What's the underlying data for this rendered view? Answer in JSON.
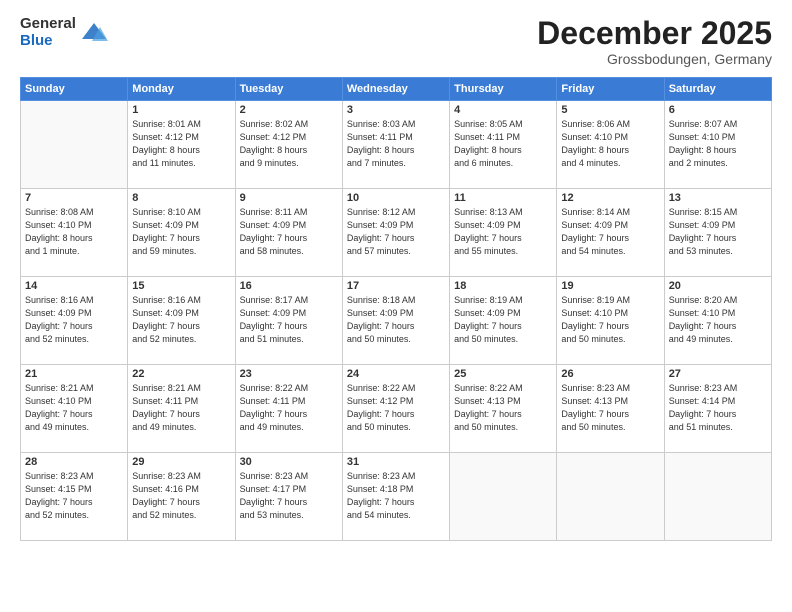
{
  "logo": {
    "general": "General",
    "blue": "Blue"
  },
  "title": "December 2025",
  "location": "Grossbodungen, Germany",
  "days_header": [
    "Sunday",
    "Monday",
    "Tuesday",
    "Wednesday",
    "Thursday",
    "Friday",
    "Saturday"
  ],
  "weeks": [
    [
      {
        "day": "",
        "info": ""
      },
      {
        "day": "1",
        "info": "Sunrise: 8:01 AM\nSunset: 4:12 PM\nDaylight: 8 hours\nand 11 minutes."
      },
      {
        "day": "2",
        "info": "Sunrise: 8:02 AM\nSunset: 4:12 PM\nDaylight: 8 hours\nand 9 minutes."
      },
      {
        "day": "3",
        "info": "Sunrise: 8:03 AM\nSunset: 4:11 PM\nDaylight: 8 hours\nand 7 minutes."
      },
      {
        "day": "4",
        "info": "Sunrise: 8:05 AM\nSunset: 4:11 PM\nDaylight: 8 hours\nand 6 minutes."
      },
      {
        "day": "5",
        "info": "Sunrise: 8:06 AM\nSunset: 4:10 PM\nDaylight: 8 hours\nand 4 minutes."
      },
      {
        "day": "6",
        "info": "Sunrise: 8:07 AM\nSunset: 4:10 PM\nDaylight: 8 hours\nand 2 minutes."
      }
    ],
    [
      {
        "day": "7",
        "info": "Sunrise: 8:08 AM\nSunset: 4:10 PM\nDaylight: 8 hours\nand 1 minute."
      },
      {
        "day": "8",
        "info": "Sunrise: 8:10 AM\nSunset: 4:09 PM\nDaylight: 7 hours\nand 59 minutes."
      },
      {
        "day": "9",
        "info": "Sunrise: 8:11 AM\nSunset: 4:09 PM\nDaylight: 7 hours\nand 58 minutes."
      },
      {
        "day": "10",
        "info": "Sunrise: 8:12 AM\nSunset: 4:09 PM\nDaylight: 7 hours\nand 57 minutes."
      },
      {
        "day": "11",
        "info": "Sunrise: 8:13 AM\nSunset: 4:09 PM\nDaylight: 7 hours\nand 55 minutes."
      },
      {
        "day": "12",
        "info": "Sunrise: 8:14 AM\nSunset: 4:09 PM\nDaylight: 7 hours\nand 54 minutes."
      },
      {
        "day": "13",
        "info": "Sunrise: 8:15 AM\nSunset: 4:09 PM\nDaylight: 7 hours\nand 53 minutes."
      }
    ],
    [
      {
        "day": "14",
        "info": "Sunrise: 8:16 AM\nSunset: 4:09 PM\nDaylight: 7 hours\nand 52 minutes."
      },
      {
        "day": "15",
        "info": "Sunrise: 8:16 AM\nSunset: 4:09 PM\nDaylight: 7 hours\nand 52 minutes."
      },
      {
        "day": "16",
        "info": "Sunrise: 8:17 AM\nSunset: 4:09 PM\nDaylight: 7 hours\nand 51 minutes."
      },
      {
        "day": "17",
        "info": "Sunrise: 8:18 AM\nSunset: 4:09 PM\nDaylight: 7 hours\nand 50 minutes."
      },
      {
        "day": "18",
        "info": "Sunrise: 8:19 AM\nSunset: 4:09 PM\nDaylight: 7 hours\nand 50 minutes."
      },
      {
        "day": "19",
        "info": "Sunrise: 8:19 AM\nSunset: 4:10 PM\nDaylight: 7 hours\nand 50 minutes."
      },
      {
        "day": "20",
        "info": "Sunrise: 8:20 AM\nSunset: 4:10 PM\nDaylight: 7 hours\nand 49 minutes."
      }
    ],
    [
      {
        "day": "21",
        "info": "Sunrise: 8:21 AM\nSunset: 4:10 PM\nDaylight: 7 hours\nand 49 minutes."
      },
      {
        "day": "22",
        "info": "Sunrise: 8:21 AM\nSunset: 4:11 PM\nDaylight: 7 hours\nand 49 minutes."
      },
      {
        "day": "23",
        "info": "Sunrise: 8:22 AM\nSunset: 4:11 PM\nDaylight: 7 hours\nand 49 minutes."
      },
      {
        "day": "24",
        "info": "Sunrise: 8:22 AM\nSunset: 4:12 PM\nDaylight: 7 hours\nand 50 minutes."
      },
      {
        "day": "25",
        "info": "Sunrise: 8:22 AM\nSunset: 4:13 PM\nDaylight: 7 hours\nand 50 minutes."
      },
      {
        "day": "26",
        "info": "Sunrise: 8:23 AM\nSunset: 4:13 PM\nDaylight: 7 hours\nand 50 minutes."
      },
      {
        "day": "27",
        "info": "Sunrise: 8:23 AM\nSunset: 4:14 PM\nDaylight: 7 hours\nand 51 minutes."
      }
    ],
    [
      {
        "day": "28",
        "info": "Sunrise: 8:23 AM\nSunset: 4:15 PM\nDaylight: 7 hours\nand 52 minutes."
      },
      {
        "day": "29",
        "info": "Sunrise: 8:23 AM\nSunset: 4:16 PM\nDaylight: 7 hours\nand 52 minutes."
      },
      {
        "day": "30",
        "info": "Sunrise: 8:23 AM\nSunset: 4:17 PM\nDaylight: 7 hours\nand 53 minutes."
      },
      {
        "day": "31",
        "info": "Sunrise: 8:23 AM\nSunset: 4:18 PM\nDaylight: 7 hours\nand 54 minutes."
      },
      {
        "day": "",
        "info": ""
      },
      {
        "day": "",
        "info": ""
      },
      {
        "day": "",
        "info": ""
      }
    ]
  ]
}
